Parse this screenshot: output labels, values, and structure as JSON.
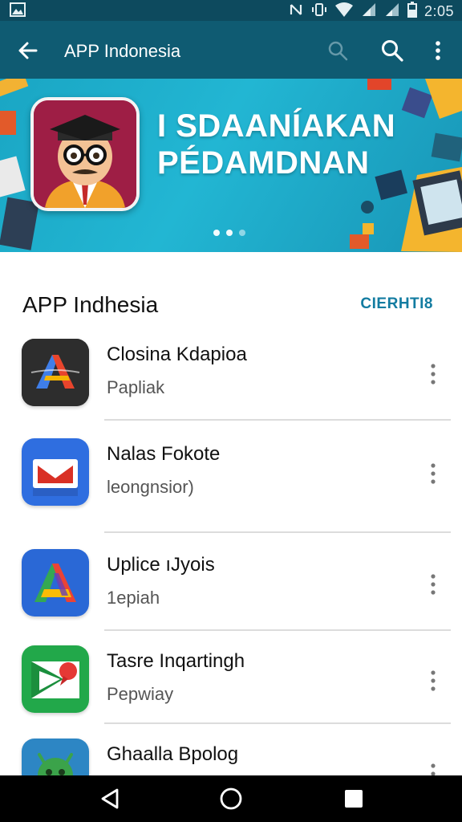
{
  "status_bar": {
    "time": "2:05",
    "icons": [
      "image-icon",
      "nfc-icon",
      "vibrate-icon",
      "wifi-icon",
      "signal-icon",
      "signal-icon",
      "battery-icon"
    ]
  },
  "app_bar": {
    "title": "APP Indonesia",
    "icons": [
      "back-arrow-icon",
      "search-icon",
      "search-icon",
      "more-vert-icon"
    ]
  },
  "banner": {
    "headline_line1": "I SDAANÍAKAN",
    "headline_line2": "PÉDAMDNAN",
    "page_dots": 3,
    "active_dot": 1,
    "background": "#1aa6c4"
  },
  "section": {
    "title": "APP Indhesia",
    "action": "CIERHTI8",
    "accent": "#137ca1"
  },
  "apps": [
    {
      "name": "Closina Kdapioa",
      "subtitle": "Papliak",
      "icon": "letter-a-icon"
    },
    {
      "name": "Nalas Fokote",
      "subtitle": "leongnsior)",
      "icon": "mail-icon"
    },
    {
      "name": "Uplice ıJyois",
      "subtitle": "1epiah",
      "icon": "letter-a-icon"
    },
    {
      "name": "Tasre Inqartingh",
      "subtitle": "Pepwiay",
      "icon": "play-pin-icon"
    },
    {
      "name": "Ghaalla Bpolog",
      "subtitle": "",
      "icon": "android-icon"
    }
  ],
  "nav_bar": {
    "icons": [
      "back-triangle-icon",
      "home-circle-icon",
      "recents-square-icon"
    ]
  }
}
